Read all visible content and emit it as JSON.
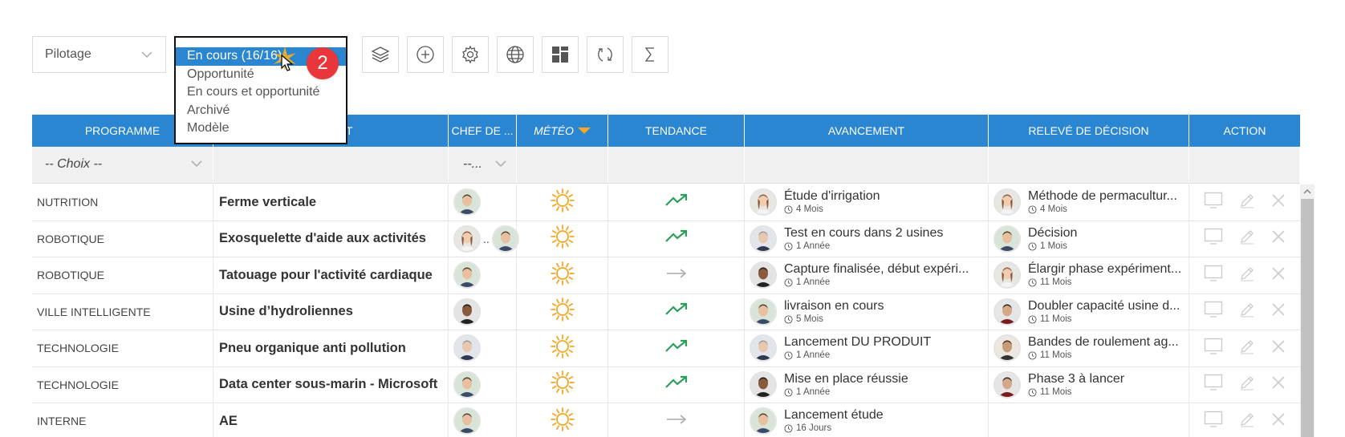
{
  "toolbar": {
    "pilotage_label": "Pilotage",
    "status_options": [
      "En cours (16/16)",
      "Opportunité",
      "En cours et opportunité",
      "Archivé",
      "Modèle"
    ],
    "selected_index": 0,
    "step_badge": "2",
    "buttons": [
      {
        "name": "layers-button",
        "icon": "layers-icon"
      },
      {
        "name": "add-button",
        "icon": "plus-circle-icon"
      },
      {
        "name": "settings-button",
        "icon": "gear-icon"
      },
      {
        "name": "globe-button",
        "icon": "globe-icon"
      },
      {
        "name": "dashboard-button",
        "icon": "grid-icon"
      },
      {
        "name": "refresh-button",
        "icon": "refresh-icon"
      },
      {
        "name": "sum-button",
        "icon": "sigma-icon"
      }
    ]
  },
  "table": {
    "headers": [
      "PROGRAMME",
      "PROJET",
      "CHEF DE ...",
      "MÉTÉO",
      "TENDANCE",
      "AVANCEMENT",
      "RELEVÉ DE DÉCISION",
      "ACTION"
    ],
    "filters": {
      "programme": "-- Choix --",
      "chef": "--..."
    },
    "rows": [
      {
        "programme": "NUTRITION",
        "projet": "Ferme verticale",
        "chefs": [
          "man1"
        ],
        "meteo": "sun",
        "tendance": "up",
        "avancement": {
          "avatar": "woman",
          "text": "Étude d'irrigation",
          "duration": "4 Mois"
        },
        "decision": {
          "avatar": "woman",
          "text": "Méthode de permacultur...",
          "duration": "4 Mois"
        }
      },
      {
        "programme": "ROBOTIQUE",
        "projet": "Exosquelette d'aide aux activités",
        "chefs": [
          "woman",
          "man1"
        ],
        "meteo": "sun",
        "tendance": "up",
        "avancement": {
          "avatar": "man2",
          "text": "Test en cours dans 2 usines",
          "duration": "1 Année"
        },
        "decision": {
          "avatar": "man1",
          "text": "Décision",
          "duration": "1 Mois"
        }
      },
      {
        "programme": "ROBOTIQUE",
        "projet": "Tatouage pour l'activité cardiaque",
        "chefs": [
          "man1"
        ],
        "meteo": "sun",
        "tendance": "flat",
        "avancement": {
          "avatar": "man3",
          "text": "Capture finalisée, début expéri...",
          "duration": "1 Année"
        },
        "decision": {
          "avatar": "woman",
          "text": "Élargir phase expériment...",
          "duration": "11 Mois"
        }
      },
      {
        "programme": "VILLE INTELLIGENTE",
        "projet": "Usine d’hydroliennes",
        "chefs": [
          "man3"
        ],
        "meteo": "sun",
        "tendance": "up",
        "avancement": {
          "avatar": "man1",
          "text": "livraison en cours",
          "duration": "5 Mois"
        },
        "decision": {
          "avatar": "man4",
          "text": "Doubler capacité usine d...",
          "duration": "11 Mois"
        }
      },
      {
        "programme": "TECHNOLOGIE",
        "projet": "Pneu organique anti pollution",
        "chefs": [
          "man2"
        ],
        "meteo": "sun",
        "tendance": "up",
        "avancement": {
          "avatar": "man2",
          "text": "Lancement DU PRODUIT",
          "duration": "1 Année"
        },
        "decision": {
          "avatar": "man5",
          "text": "Bandes de roulement ag...",
          "duration": "11 Mois"
        }
      },
      {
        "programme": "TECHNOLOGIE",
        "projet": "Data center sous-marin - Microsoft",
        "chefs": [
          "man1"
        ],
        "meteo": "sun",
        "tendance": "up",
        "avancement": {
          "avatar": "man3",
          "text": "Mise en place réussie",
          "duration": "1 Année"
        },
        "decision": {
          "avatar": "man4",
          "text": "Phase 3 à lancer",
          "duration": "11 Mois"
        }
      },
      {
        "programme": "INTERNE",
        "projet": "AE",
        "chefs": [
          "man1"
        ],
        "meteo": "sun",
        "tendance": "flat",
        "avancement": {
          "avatar": "man1",
          "text": "Lancement étude",
          "duration": "16 Jours"
        },
        "decision": null
      }
    ]
  },
  "colors": {
    "header_blue": "#2a86d0",
    "sun": "#f5a623",
    "trend_up": "#2e9e5b",
    "trend_flat": "#aaaaaa",
    "badge": "#e8363c"
  }
}
